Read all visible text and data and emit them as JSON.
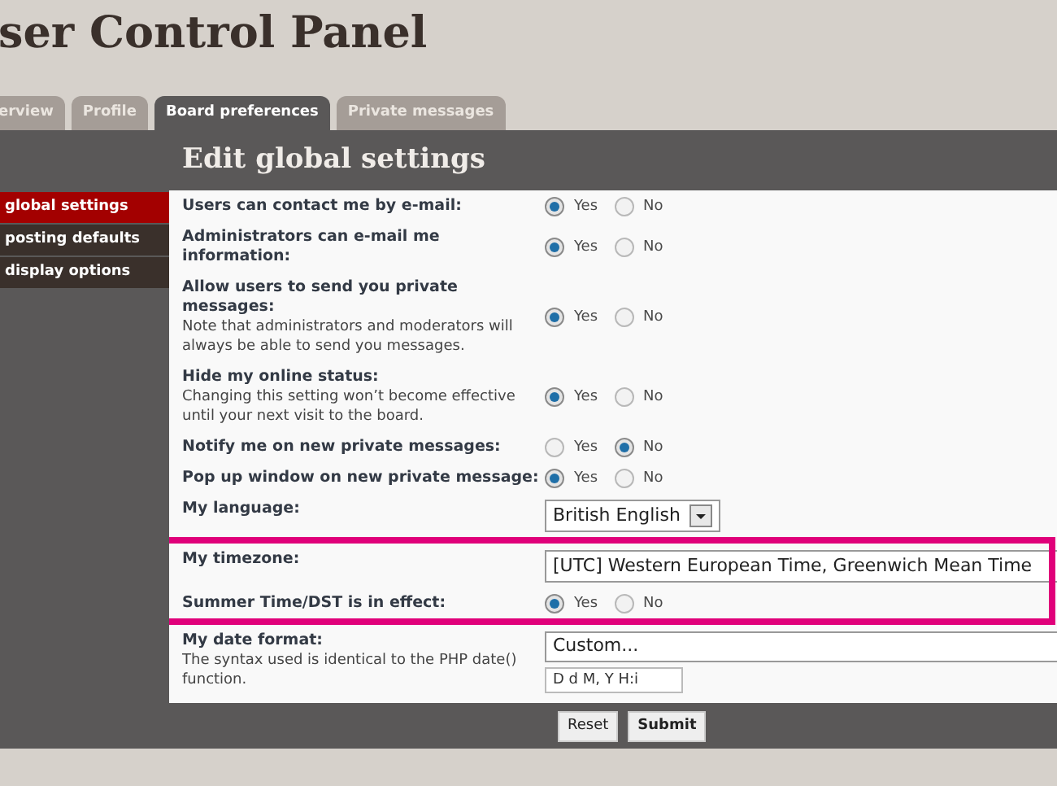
{
  "page_title": "ser Control Panel",
  "tabs": [
    {
      "label": "erview",
      "selected": false
    },
    {
      "label": "Profile",
      "selected": false
    },
    {
      "label": "Board preferences",
      "selected": true
    },
    {
      "label": "Private messages",
      "selected": false
    }
  ],
  "sidebar": {
    "items": [
      {
        "label": "global settings",
        "selected": true
      },
      {
        "label": "posting defaults",
        "selected": false
      },
      {
        "label": "display options",
        "selected": false
      }
    ]
  },
  "heading": "Edit global settings",
  "settings": [
    {
      "kind": "radio",
      "label": "Users can contact me by e-mail:",
      "options": [
        {
          "label": "Yes",
          "selected": true
        },
        {
          "label": "No",
          "selected": false
        }
      ]
    },
    {
      "kind": "radio",
      "label": "Administrators can e-mail me information:",
      "options": [
        {
          "label": "Yes",
          "selected": true
        },
        {
          "label": "No",
          "selected": false
        }
      ]
    },
    {
      "kind": "radio",
      "label": "Allow users to send you private messages:",
      "note": "Note that administrators and moderators will always be able to send you messages.",
      "options": [
        {
          "label": "Yes",
          "selected": true
        },
        {
          "label": "No",
          "selected": false
        }
      ]
    },
    {
      "kind": "radio",
      "label": "Hide my online status:",
      "note": "Changing this setting won’t become effective until your next visit to the board.",
      "options": [
        {
          "label": "Yes",
          "selected": true
        },
        {
          "label": "No",
          "selected": false
        }
      ]
    },
    {
      "kind": "radio",
      "label": "Notify me on new private messages:",
      "options": [
        {
          "label": "Yes",
          "selected": false
        },
        {
          "label": "No",
          "selected": true
        }
      ]
    },
    {
      "kind": "radio",
      "label": "Pop up window on new private message:",
      "options": [
        {
          "label": "Yes",
          "selected": true
        },
        {
          "label": "No",
          "selected": false
        }
      ]
    },
    {
      "kind": "select",
      "label": "My language:",
      "value": "British English"
    },
    {
      "kind": "select_wide",
      "label": "My timezone:",
      "value": "[UTC] Western European Time, Greenwich Mean Time",
      "highlighted": true
    },
    {
      "kind": "radio",
      "label": "Summer Time/DST is in effect:",
      "highlighted": true,
      "options": [
        {
          "label": "Yes",
          "selected": true
        },
        {
          "label": "No",
          "selected": false
        }
      ]
    },
    {
      "kind": "date",
      "label": "My date format:",
      "note": "The syntax used is identical to the PHP date() function.",
      "value": "Custom...",
      "input": "D d M, Y H:i"
    }
  ],
  "buttons": [
    "Reset",
    "Submit"
  ]
}
